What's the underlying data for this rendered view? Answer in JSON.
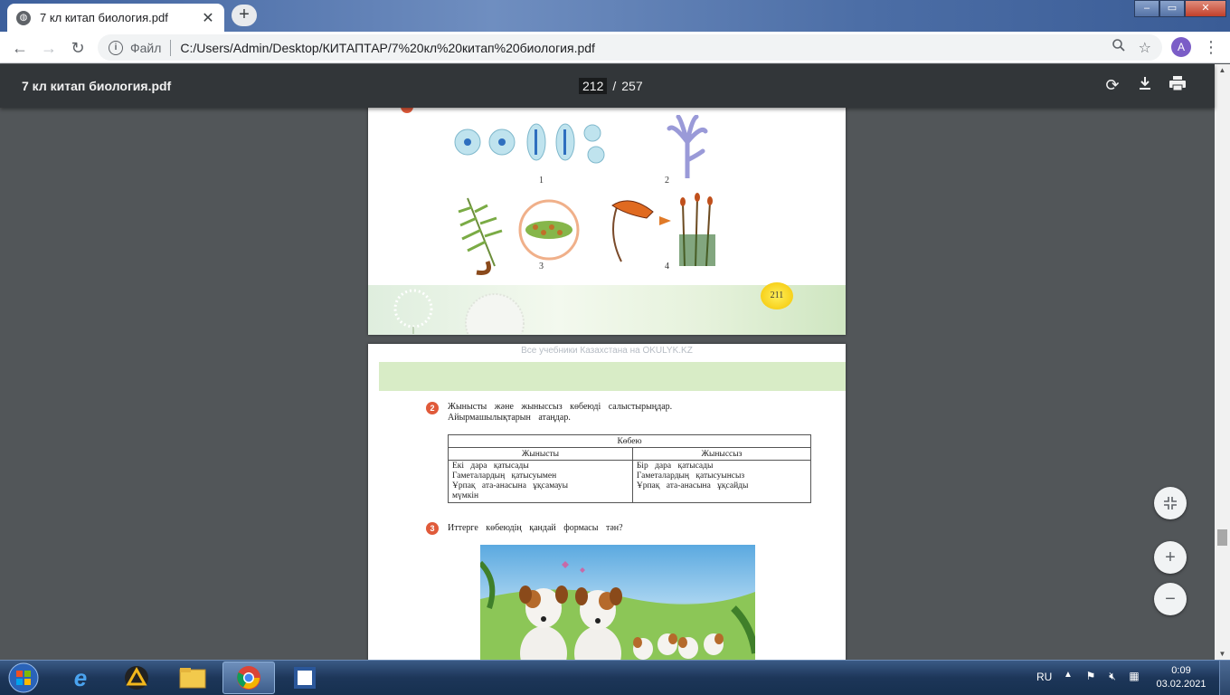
{
  "browser": {
    "tab": {
      "title": "7 кл китап биология.pdf",
      "close": "✕"
    },
    "new_tab": "+",
    "window_controls": {
      "minimize": "–",
      "maximize": "▭",
      "close": "✕"
    },
    "address": {
      "scheme_label": "Файл",
      "url": "C:/Users/Admin/Desktop/КИТАПТАР/7%20кл%20китап%20биология.pdf"
    },
    "profile_initial": "A"
  },
  "pdf_viewer": {
    "title": "7 кл китап биология.pdf",
    "current_page": "212",
    "page_separator": "/",
    "total_pages": "257",
    "zoom_in": "+",
    "zoom_out": "−"
  },
  "page_prev": {
    "figure_labels": [
      "1",
      "2",
      "3",
      "4"
    ],
    "page_number": "211"
  },
  "page_current": {
    "site_watermark": "Все учебники Казахстана на OKULYK.KZ",
    "q2": {
      "num": "2",
      "line1": "Жынысты және жыныссыз көбеюді салыстырыңдар.",
      "line2": "Айырмашылықтарын атаңдар."
    },
    "table": {
      "header": "Көбею",
      "col_left": "Жынысты",
      "col_right": "Жыныссыз",
      "left_cells": [
        "Екі дара қатысады",
        "Гаметалардың қатысуымен",
        "Ұрпақ ата-анасына ұқсамауы",
        "мүмкін"
      ],
      "right_cells": [
        "Бір дара қатысады",
        "Гаметалардың қатысуынсыз",
        "Ұрпақ ата-анасына ұқсайды"
      ]
    },
    "q3": {
      "num": "3",
      "text": "Иттерге көбеюдің қандай формасы тән?"
    }
  },
  "taskbar": {
    "language": "RU",
    "time": "0:09",
    "date": "03.02.2021"
  },
  "colors": {
    "pdf_toolbar": "#323639",
    "viewer_bg": "#525659",
    "question_badge": "#e05a3a",
    "green_band": "#d8ecc6"
  }
}
